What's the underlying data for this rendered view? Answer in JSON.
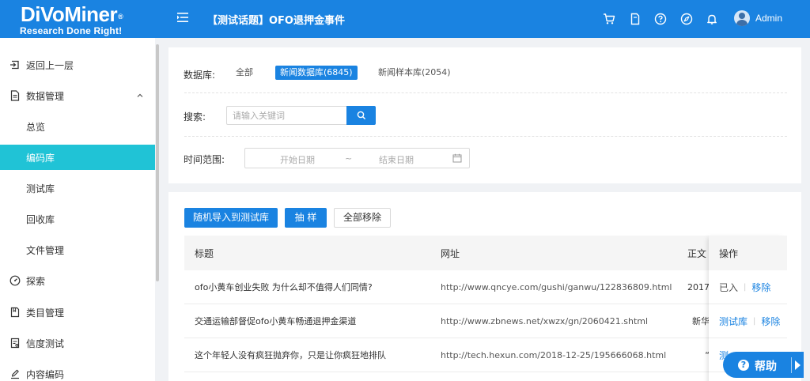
{
  "header": {
    "brand": "DiVoMiner",
    "brand_mark": "®",
    "tagline": "Research Done Right!",
    "title": "【测试话题】OFO退押金事件",
    "username": "Admin",
    "icons": [
      "cart-icon",
      "document-icon",
      "help-circle-icon",
      "compass-icon",
      "bell-icon"
    ]
  },
  "sidebar": {
    "items": [
      {
        "label": "返回上一层",
        "icon": "back-icon"
      },
      {
        "label": "数据管理",
        "icon": "data-file-icon"
      },
      {
        "label": "总览"
      },
      {
        "label": "编码库",
        "active": true
      },
      {
        "label": "测试库"
      },
      {
        "label": "回收库"
      },
      {
        "label": "文件管理"
      },
      {
        "label": "探索",
        "icon": "dashboard-icon"
      },
      {
        "label": "类目管理",
        "icon": "category-icon"
      },
      {
        "label": "信度测试",
        "icon": "reliability-icon"
      },
      {
        "label": "内容编码",
        "icon": "edit-icon"
      }
    ]
  },
  "filters": {
    "database_label": "数据库:",
    "db_options": [
      "全部",
      "新闻数据库(6845)",
      "新闻样本库(2054)"
    ],
    "selected_db": "新闻数据库(6845)",
    "search_label": "搜索:",
    "search_placeholder": "请输入关键词",
    "search_value": "",
    "time_label": "时间范围:",
    "start_placeholder": "开始日期",
    "range_sep": "~",
    "end_placeholder": "结束日期"
  },
  "actions": {
    "random_import": "随机导入到测试库",
    "sample": "抽 样",
    "remove_all": "全部移除"
  },
  "table": {
    "columns": [
      "标题",
      "网址",
      "正文",
      "操作"
    ],
    "rows": [
      {
        "title": "ofo小黄车创业失败 为什么却不值得人们同情?",
        "url": "http://www.qncye.com/gushi/ganwu/122836809.html",
        "text": "2017",
        "op1": "已入",
        "op2": "移除"
      },
      {
        "title": "交通运输部督促ofo小黄车畅通退押金渠道",
        "url": "http://www.zbnews.net/xwzx/gn/2060421.shtml",
        "text": "新华",
        "op1": "测试库",
        "op2": "移除"
      },
      {
        "title": "这个年轻人没有疯狂抛弃你，只是让你疯狂地排队",
        "url": "http://tech.hexun.com/2018-12-25/195666068.html",
        "text": "“",
        "op1": "测",
        "op2": ""
      }
    ]
  },
  "help": {
    "label": "帮助",
    "glyph": "?"
  },
  "colors": {
    "primary": "#1a83e1",
    "active_nav": "#20c3d6",
    "background": "#f0f2f5"
  }
}
